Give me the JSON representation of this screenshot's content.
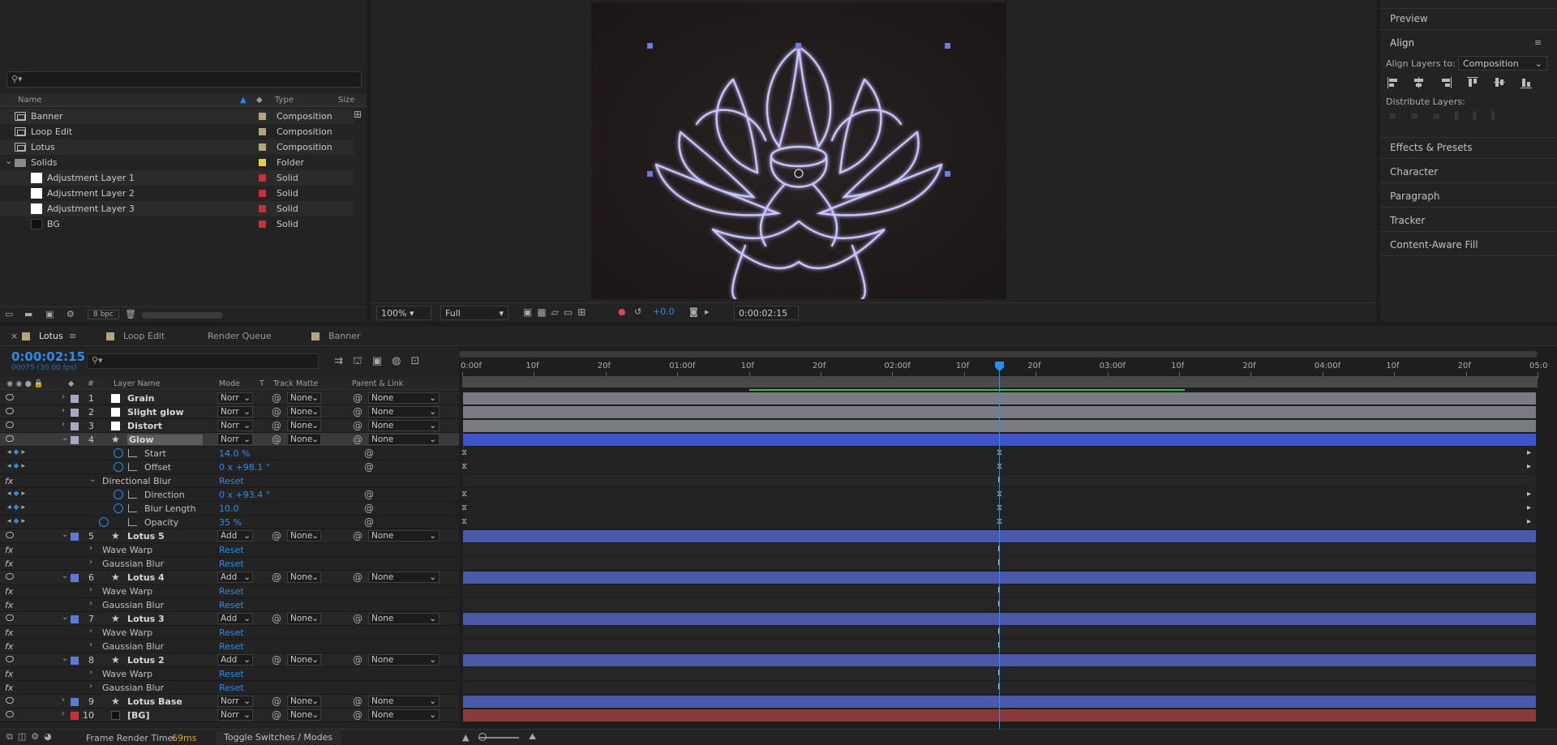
{
  "project": {
    "search_placeholder": "",
    "headers": {
      "name": "Name",
      "type": "Type",
      "size": "Size"
    },
    "items": [
      {
        "name": "Banner",
        "type": "Composition",
        "icon": "composition-icon",
        "color": "#b5a47a"
      },
      {
        "name": "Loop Edit",
        "type": "Composition",
        "icon": "composition-icon",
        "color": "#b5a47a"
      },
      {
        "name": "Lotus",
        "type": "Composition",
        "icon": "composition-icon",
        "color": "#b5a47a"
      },
      {
        "name": "Solids",
        "type": "Folder",
        "icon": "folder-icon",
        "color": "#e0d040"
      },
      {
        "name": "Adjustment Layer 1",
        "type": "Solid",
        "icon": "solid-icon",
        "color": "#c83232"
      },
      {
        "name": "Adjustment Layer 2",
        "type": "Solid",
        "icon": "solid-icon",
        "color": "#c83232"
      },
      {
        "name": "Adjustment Layer 3",
        "type": "Solid",
        "icon": "solid-icon",
        "color": "#c83232"
      },
      {
        "name": "BG",
        "type": "Solid",
        "icon": "solid-icon-dark",
        "color": "#c83232"
      }
    ],
    "bpc": "8 bpc"
  },
  "viewer": {
    "zoom": "100%",
    "quality": "Full",
    "exposure": "+0.0",
    "timecode": "0:00:02:15"
  },
  "right_panel": {
    "preview": "Preview",
    "align": "Align",
    "align_to_label": "Align Layers to:",
    "align_to_value": "Composition",
    "distribute": "Distribute Layers:",
    "effects": "Effects & Presets",
    "character": "Character",
    "paragraph": "Paragraph",
    "tracker": "Tracker",
    "content_aware": "Content-Aware Fill"
  },
  "tabs": [
    {
      "label": "Lotus",
      "color": "#b5a47a",
      "active": true
    },
    {
      "label": "Loop Edit",
      "color": "#b5a47a"
    },
    {
      "label": "Render Queue"
    },
    {
      "label": "Banner",
      "color": "#b5a47a"
    }
  ],
  "timeline": {
    "timecode": "0:00:02:15",
    "frames": "00075 (30.00 fps)",
    "headers": {
      "hash": "#",
      "layer_name": "Layer Name",
      "mode": "Mode",
      "t": "T",
      "track_matte": "Track Matte",
      "parent": "Parent & Link"
    },
    "ruler": [
      "0:00f",
      "10f",
      "20f",
      "01:00f",
      "10f",
      "20f",
      "02:00f",
      "10f",
      "20f",
      "03:00f",
      "10f",
      "20f",
      "04:00f",
      "10f",
      "20f",
      "05:0"
    ],
    "frame_render_label": "Frame Render Time:",
    "frame_render_value": "69ms",
    "toggle": "Toggle Switches / Modes"
  },
  "layers": [
    {
      "kind": "layer",
      "num": "1",
      "name": "Grain",
      "label": "#a6a6c8",
      "icon": "white",
      "mode": "Norr",
      "matte": "None",
      "parent": "None",
      "twirl": "›"
    },
    {
      "kind": "layer",
      "num": "2",
      "name": "Slight glow",
      "label": "#a6a6c8",
      "icon": "white",
      "mode": "Norr",
      "matte": "None",
      "parent": "None",
      "twirl": "›"
    },
    {
      "kind": "layer",
      "num": "3",
      "name": "Distort",
      "label": "#a6a6c8",
      "icon": "white",
      "mode": "Norr",
      "matte": "None",
      "parent": "None",
      "twirl": "›"
    },
    {
      "kind": "layer",
      "num": "4",
      "name": "Glow",
      "label": "#a6a6c8",
      "icon": "star",
      "mode": "Norr",
      "matte": "None",
      "parent": "None",
      "twirl": "⌄",
      "selected": true
    },
    {
      "kind": "prop",
      "name": "Start",
      "value": "14.0 %",
      "indent": "stopwatch"
    },
    {
      "kind": "prop",
      "name": "Offset",
      "value": "0 x +98.1 °",
      "indent": "stopwatch"
    },
    {
      "kind": "effect",
      "name": "Directional Blur",
      "value": "Reset",
      "twirl": "⌄"
    },
    {
      "kind": "prop",
      "name": "Direction",
      "value": "0 x +93.4 °",
      "indent": "stopwatch"
    },
    {
      "kind": "prop",
      "name": "Blur Length",
      "value": "10.0",
      "indent": "stopwatch"
    },
    {
      "kind": "prop",
      "name": "Opacity",
      "value": "35 %",
      "indent": "stopwatch-left"
    },
    {
      "kind": "layer",
      "num": "5",
      "name": "Lotus 5",
      "label": "#5b7ad8",
      "icon": "star",
      "mode": "Add",
      "matte": "None",
      "parent": "None",
      "twirl": "⌄"
    },
    {
      "kind": "effect",
      "name": "Wave Warp",
      "value": "Reset",
      "twirl": "›"
    },
    {
      "kind": "effect",
      "name": "Gaussian Blur",
      "value": "Reset",
      "twirl": "›"
    },
    {
      "kind": "layer",
      "num": "6",
      "name": "Lotus 4",
      "label": "#5b7ad8",
      "icon": "star",
      "mode": "Add",
      "matte": "None",
      "parent": "None",
      "twirl": "⌄"
    },
    {
      "kind": "effect",
      "name": "Wave Warp",
      "value": "Reset",
      "twirl": "›"
    },
    {
      "kind": "effect",
      "name": "Gaussian Blur",
      "value": "Reset",
      "twirl": "›"
    },
    {
      "kind": "layer",
      "num": "7",
      "name": "Lotus 3",
      "label": "#5b7ad8",
      "icon": "star",
      "mode": "Add",
      "matte": "None",
      "parent": "None",
      "twirl": "⌄"
    },
    {
      "kind": "effect",
      "name": "Wave Warp",
      "value": "Reset",
      "twirl": "›"
    },
    {
      "kind": "effect",
      "name": "Gaussian Blur",
      "value": "Reset",
      "twirl": "›"
    },
    {
      "kind": "layer",
      "num": "8",
      "name": "Lotus 2",
      "label": "#5b7ad8",
      "icon": "star",
      "mode": "Add",
      "matte": "None",
      "parent": "None",
      "twirl": "⌄"
    },
    {
      "kind": "effect",
      "name": "Wave Warp",
      "value": "Reset",
      "twirl": "›"
    },
    {
      "kind": "effect",
      "name": "Gaussian Blur",
      "value": "Reset",
      "twirl": "›"
    },
    {
      "kind": "layer",
      "num": "9",
      "name": "Lotus Base",
      "label": "#5b7ad8",
      "icon": "star",
      "mode": "Norr",
      "matte": "None",
      "parent": "None",
      "twirl": "›"
    },
    {
      "kind": "layer",
      "num": "10",
      "name": "[BG]",
      "label": "#c83232",
      "icon": "dark",
      "mode": "Norr",
      "matte": "None",
      "parent": "None",
      "twirl": "›"
    }
  ],
  "colors": {
    "accent": "#2d8ceb",
    "layer_bar_gray": "#7a7a82",
    "layer_bar_glow": "#3c55c8",
    "layer_bar_blue": "#4a5aa8",
    "layer_bar_red": "#8a3a3a",
    "work_area_green": "#3fbf3f"
  }
}
